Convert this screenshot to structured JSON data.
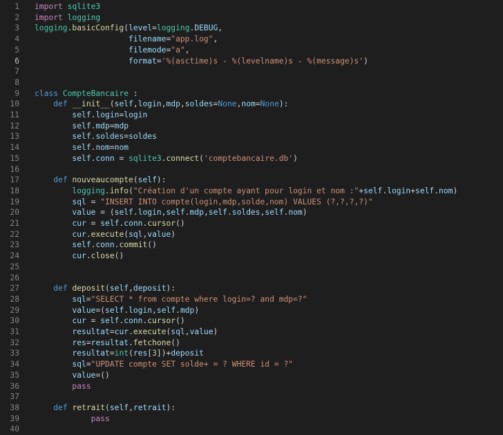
{
  "editor": {
    "current_line": 6,
    "colors": {
      "background": "#1e1e1e",
      "line_number": "#858585",
      "keyword": "#569cd6",
      "control": "#c586c0",
      "function": "#dcdcaa",
      "variable": "#9cdcfe",
      "string": "#ce9178",
      "class": "#4ec9b0",
      "number": "#b5cea8",
      "default": "#d4d4d4"
    },
    "lines": [
      {
        "n": "1",
        "tokens": [
          [
            "ctl",
            "import"
          ],
          [
            "op",
            " "
          ],
          [
            "cls",
            "sqlite3"
          ]
        ]
      },
      {
        "n": "2",
        "tokens": [
          [
            "ctl",
            "import"
          ],
          [
            "op",
            " "
          ],
          [
            "cls",
            "logging"
          ]
        ]
      },
      {
        "n": "3",
        "tokens": [
          [
            "cls",
            "logging"
          ],
          [
            "op",
            "."
          ],
          [
            "fn",
            "basicConfig"
          ],
          [
            "op",
            "("
          ],
          [
            "var",
            "level"
          ],
          [
            "op",
            "="
          ],
          [
            "cls",
            "logging"
          ],
          [
            "op",
            "."
          ],
          [
            "var",
            "DEBUG"
          ],
          [
            "op",
            ","
          ]
        ]
      },
      {
        "n": "4",
        "tokens": [
          [
            "op",
            "                    "
          ],
          [
            "var",
            "filename"
          ],
          [
            "op",
            "="
          ],
          [
            "str",
            "\"app.log\""
          ],
          [
            "op",
            ","
          ]
        ]
      },
      {
        "n": "5",
        "tokens": [
          [
            "op",
            "                    "
          ],
          [
            "var",
            "filemode"
          ],
          [
            "op",
            "="
          ],
          [
            "str",
            "\"a\""
          ],
          [
            "op",
            ","
          ]
        ]
      },
      {
        "n": "6",
        "tokens": [
          [
            "op",
            "                    "
          ],
          [
            "var",
            "format"
          ],
          [
            "op",
            "="
          ],
          [
            "str",
            "'%(asctime)s - %(levelname)s - %(message)s'"
          ],
          [
            "op",
            ")"
          ]
        ]
      },
      {
        "n": "7",
        "tokens": []
      },
      {
        "n": "8",
        "tokens": []
      },
      {
        "n": "9",
        "tokens": [
          [
            "kw",
            "class"
          ],
          [
            "op",
            " "
          ],
          [
            "cls",
            "CompteBancaire"
          ],
          [
            "op",
            " :"
          ]
        ]
      },
      {
        "n": "10",
        "tokens": [
          [
            "op",
            "    "
          ],
          [
            "kw",
            "def"
          ],
          [
            "op",
            " "
          ],
          [
            "fn",
            "__init__"
          ],
          [
            "op",
            "("
          ],
          [
            "var",
            "self"
          ],
          [
            "op",
            ","
          ],
          [
            "var",
            "login"
          ],
          [
            "op",
            ","
          ],
          [
            "var",
            "mdp"
          ],
          [
            "op",
            ","
          ],
          [
            "var",
            "soldes"
          ],
          [
            "op",
            "="
          ],
          [
            "kw",
            "None"
          ],
          [
            "op",
            ","
          ],
          [
            "var",
            "nom"
          ],
          [
            "op",
            "="
          ],
          [
            "kw",
            "None"
          ],
          [
            "op",
            "):"
          ]
        ]
      },
      {
        "n": "11",
        "tokens": [
          [
            "op",
            "        "
          ],
          [
            "var",
            "self"
          ],
          [
            "op",
            "."
          ],
          [
            "var",
            "login"
          ],
          [
            "op",
            "="
          ],
          [
            "var",
            "login"
          ]
        ]
      },
      {
        "n": "12",
        "tokens": [
          [
            "op",
            "        "
          ],
          [
            "var",
            "self"
          ],
          [
            "op",
            "."
          ],
          [
            "var",
            "mdp"
          ],
          [
            "op",
            "="
          ],
          [
            "var",
            "mdp"
          ]
        ]
      },
      {
        "n": "13",
        "tokens": [
          [
            "op",
            "        "
          ],
          [
            "var",
            "self"
          ],
          [
            "op",
            "."
          ],
          [
            "var",
            "soldes"
          ],
          [
            "op",
            "="
          ],
          [
            "var",
            "soldes"
          ]
        ]
      },
      {
        "n": "14",
        "tokens": [
          [
            "op",
            "        "
          ],
          [
            "var",
            "self"
          ],
          [
            "op",
            "."
          ],
          [
            "var",
            "nom"
          ],
          [
            "op",
            "="
          ],
          [
            "var",
            "nom"
          ]
        ]
      },
      {
        "n": "15",
        "tokens": [
          [
            "op",
            "        "
          ],
          [
            "var",
            "self"
          ],
          [
            "op",
            "."
          ],
          [
            "var",
            "conn"
          ],
          [
            "op",
            " = "
          ],
          [
            "cls",
            "sqlite3"
          ],
          [
            "op",
            "."
          ],
          [
            "fn",
            "connect"
          ],
          [
            "op",
            "("
          ],
          [
            "str",
            "'comptebancaire.db'"
          ],
          [
            "op",
            ")"
          ]
        ]
      },
      {
        "n": "16",
        "tokens": []
      },
      {
        "n": "17",
        "tokens": [
          [
            "op",
            "    "
          ],
          [
            "kw",
            "def"
          ],
          [
            "op",
            " "
          ],
          [
            "fn",
            "nouveaucompte"
          ],
          [
            "op",
            "("
          ],
          [
            "var",
            "self"
          ],
          [
            "op",
            "):"
          ]
        ]
      },
      {
        "n": "18",
        "tokens": [
          [
            "op",
            "        "
          ],
          [
            "cls",
            "logging"
          ],
          [
            "op",
            "."
          ],
          [
            "fn",
            "info"
          ],
          [
            "op",
            "("
          ],
          [
            "str",
            "\"Création d'un compte ayant pour login et nom :\""
          ],
          [
            "op",
            "+"
          ],
          [
            "var",
            "self"
          ],
          [
            "op",
            "."
          ],
          [
            "var",
            "login"
          ],
          [
            "op",
            "+"
          ],
          [
            "var",
            "self"
          ],
          [
            "op",
            "."
          ],
          [
            "var",
            "nom"
          ],
          [
            "op",
            ")"
          ]
        ]
      },
      {
        "n": "19",
        "tokens": [
          [
            "op",
            "        "
          ],
          [
            "var",
            "sql"
          ],
          [
            "op",
            " = "
          ],
          [
            "str",
            "\"INSERT INTO compte(login,mdp,solde,nom) VALUES (?,?,?,?)\""
          ]
        ]
      },
      {
        "n": "20",
        "tokens": [
          [
            "op",
            "        "
          ],
          [
            "var",
            "value"
          ],
          [
            "op",
            " = ("
          ],
          [
            "var",
            "self"
          ],
          [
            "op",
            "."
          ],
          [
            "var",
            "login"
          ],
          [
            "op",
            ","
          ],
          [
            "var",
            "self"
          ],
          [
            "op",
            "."
          ],
          [
            "var",
            "mdp"
          ],
          [
            "op",
            ","
          ],
          [
            "var",
            "self"
          ],
          [
            "op",
            "."
          ],
          [
            "var",
            "soldes"
          ],
          [
            "op",
            ","
          ],
          [
            "var",
            "self"
          ],
          [
            "op",
            "."
          ],
          [
            "var",
            "nom"
          ],
          [
            "op",
            ")"
          ]
        ]
      },
      {
        "n": "21",
        "tokens": [
          [
            "op",
            "        "
          ],
          [
            "var",
            "cur"
          ],
          [
            "op",
            " = "
          ],
          [
            "var",
            "self"
          ],
          [
            "op",
            "."
          ],
          [
            "var",
            "conn"
          ],
          [
            "op",
            "."
          ],
          [
            "fn",
            "cursor"
          ],
          [
            "op",
            "()"
          ]
        ]
      },
      {
        "n": "22",
        "tokens": [
          [
            "op",
            "        "
          ],
          [
            "var",
            "cur"
          ],
          [
            "op",
            "."
          ],
          [
            "fn",
            "execute"
          ],
          [
            "op",
            "("
          ],
          [
            "var",
            "sql"
          ],
          [
            "op",
            ","
          ],
          [
            "var",
            "value"
          ],
          [
            "op",
            ")"
          ]
        ]
      },
      {
        "n": "23",
        "tokens": [
          [
            "op",
            "        "
          ],
          [
            "var",
            "self"
          ],
          [
            "op",
            "."
          ],
          [
            "var",
            "conn"
          ],
          [
            "op",
            "."
          ],
          [
            "fn",
            "commit"
          ],
          [
            "op",
            "()"
          ]
        ]
      },
      {
        "n": "24",
        "tokens": [
          [
            "op",
            "        "
          ],
          [
            "var",
            "cur"
          ],
          [
            "op",
            "."
          ],
          [
            "fn",
            "close"
          ],
          [
            "op",
            "()"
          ]
        ]
      },
      {
        "n": "25",
        "tokens": []
      },
      {
        "n": "26",
        "tokens": []
      },
      {
        "n": "27",
        "tokens": [
          [
            "op",
            "    "
          ],
          [
            "kw",
            "def"
          ],
          [
            "op",
            " "
          ],
          [
            "fn",
            "deposit"
          ],
          [
            "op",
            "("
          ],
          [
            "var",
            "self"
          ],
          [
            "op",
            ","
          ],
          [
            "var",
            "deposit"
          ],
          [
            "op",
            "):"
          ]
        ]
      },
      {
        "n": "28",
        "tokens": [
          [
            "op",
            "        "
          ],
          [
            "var",
            "sql"
          ],
          [
            "op",
            "="
          ],
          [
            "str",
            "\"SELECT * from compte where login=? and mdp=?\""
          ]
        ]
      },
      {
        "n": "29",
        "tokens": [
          [
            "op",
            "        "
          ],
          [
            "var",
            "value"
          ],
          [
            "op",
            "=("
          ],
          [
            "var",
            "self"
          ],
          [
            "op",
            "."
          ],
          [
            "var",
            "login"
          ],
          [
            "op",
            ","
          ],
          [
            "var",
            "self"
          ],
          [
            "op",
            "."
          ],
          [
            "var",
            "mdp"
          ],
          [
            "op",
            ")"
          ]
        ]
      },
      {
        "n": "30",
        "tokens": [
          [
            "op",
            "        "
          ],
          [
            "var",
            "cur"
          ],
          [
            "op",
            " = "
          ],
          [
            "var",
            "self"
          ],
          [
            "op",
            "."
          ],
          [
            "var",
            "conn"
          ],
          [
            "op",
            "."
          ],
          [
            "fn",
            "cursor"
          ],
          [
            "op",
            "()"
          ]
        ]
      },
      {
        "n": "31",
        "tokens": [
          [
            "op",
            "        "
          ],
          [
            "var",
            "resultat"
          ],
          [
            "op",
            "="
          ],
          [
            "var",
            "cur"
          ],
          [
            "op",
            "."
          ],
          [
            "fn",
            "execute"
          ],
          [
            "op",
            "("
          ],
          [
            "var",
            "sql"
          ],
          [
            "op",
            ","
          ],
          [
            "var",
            "value"
          ],
          [
            "op",
            ")"
          ]
        ]
      },
      {
        "n": "32",
        "tokens": [
          [
            "op",
            "        "
          ],
          [
            "var",
            "res"
          ],
          [
            "op",
            "="
          ],
          [
            "var",
            "resultat"
          ],
          [
            "op",
            "."
          ],
          [
            "fn",
            "fetchone"
          ],
          [
            "op",
            "()"
          ]
        ]
      },
      {
        "n": "33",
        "tokens": [
          [
            "op",
            "        "
          ],
          [
            "var",
            "resultat"
          ],
          [
            "op",
            "="
          ],
          [
            "cls",
            "int"
          ],
          [
            "op",
            "("
          ],
          [
            "var",
            "res"
          ],
          [
            "op",
            "["
          ],
          [
            "num",
            "3"
          ],
          [
            "op",
            "])+"
          ],
          [
            "var",
            "deposit"
          ]
        ]
      },
      {
        "n": "34",
        "tokens": [
          [
            "op",
            "        "
          ],
          [
            "var",
            "sql"
          ],
          [
            "op",
            "="
          ],
          [
            "str",
            "\"UPDATE compte SET solde+ = ? WHERE id = ?\""
          ]
        ]
      },
      {
        "n": "35",
        "tokens": [
          [
            "op",
            "        "
          ],
          [
            "var",
            "value"
          ],
          [
            "op",
            "=()"
          ]
        ]
      },
      {
        "n": "36",
        "tokens": [
          [
            "op",
            "        "
          ],
          [
            "ctl",
            "pass"
          ]
        ]
      },
      {
        "n": "37",
        "tokens": []
      },
      {
        "n": "38",
        "tokens": [
          [
            "op",
            "    "
          ],
          [
            "kw",
            "def"
          ],
          [
            "op",
            " "
          ],
          [
            "fn",
            "retrait"
          ],
          [
            "op",
            "("
          ],
          [
            "var",
            "self"
          ],
          [
            "op",
            ","
          ],
          [
            "var",
            "retrait"
          ],
          [
            "op",
            "):"
          ]
        ]
      },
      {
        "n": "39",
        "tokens": [
          [
            "op",
            "            "
          ],
          [
            "ctl",
            "pass"
          ]
        ]
      },
      {
        "n": "40",
        "tokens": []
      }
    ]
  }
}
